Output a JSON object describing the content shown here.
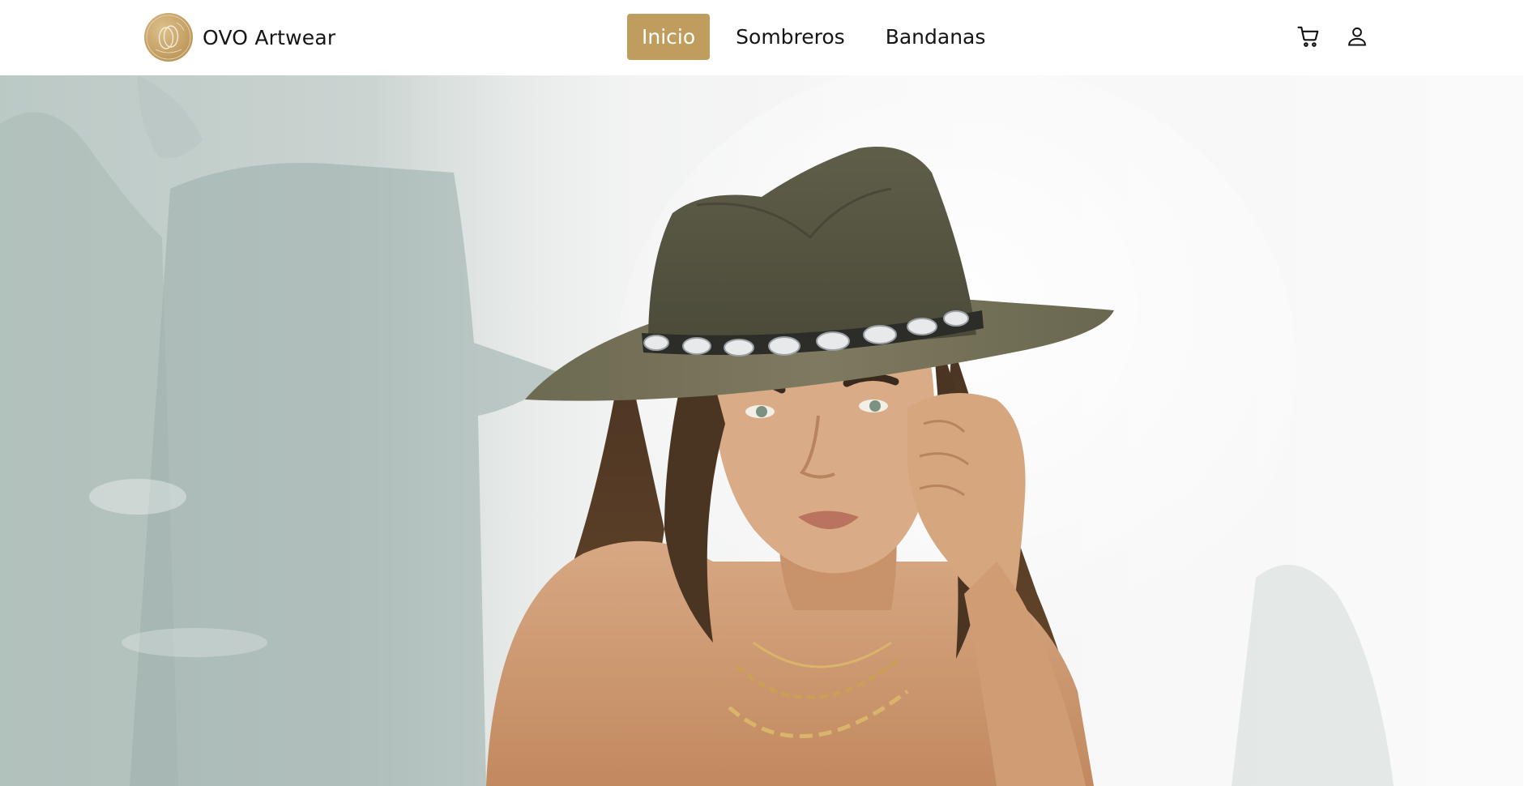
{
  "brand": {
    "name": "OVO Artwear",
    "logo_icon": "ovo-logo-icon",
    "logo_color": "#c5a166"
  },
  "nav": {
    "items": [
      {
        "label": "Inicio",
        "active": true
      },
      {
        "label": "Sombreros",
        "active": false
      },
      {
        "label": "Bandanas",
        "active": false
      }
    ],
    "accent_color": "#bf9d5e"
  },
  "icons": {
    "cart": "cart-icon",
    "user": "user-icon"
  },
  "hero": {
    "image_alt": "Mujer con sombrero verde oliva y cadena de conchas plateadas"
  }
}
